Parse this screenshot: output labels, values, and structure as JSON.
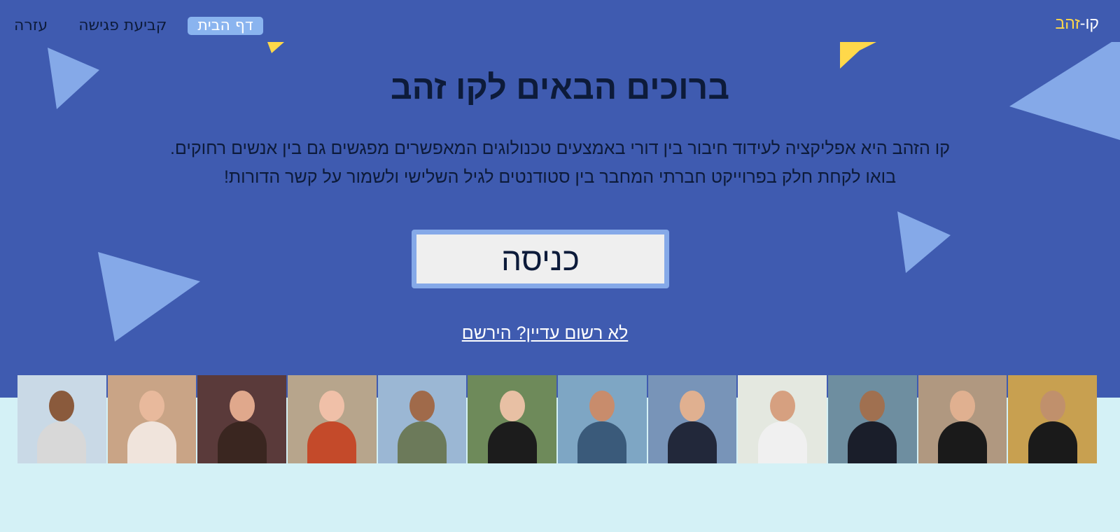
{
  "nav": {
    "items": [
      {
        "label": "עזרה"
      },
      {
        "label": "קביעת פגישה"
      },
      {
        "label": "דף הבית",
        "active": true
      }
    ]
  },
  "brand": {
    "part1": "קו-",
    "part2": "זהב"
  },
  "hero": {
    "title": "ברוכים הבאים לקו זהב",
    "description_lines": [
      "קו הזהב היא אפליקציה לעידוד חיבור בין דורי באמצעים טכנולוגים המאפשרים מפגשים גם בין אנשים רחוקים.",
      "בואו לקחת חלק בפרוייקט חברתי המחבר בין סטודנטים לגיל השלישי ולשמור על קשר הדורות!"
    ],
    "enter_button": "כניסה",
    "register_link": "לא רשום עדיין? הירשם"
  },
  "colors": {
    "hero_bg": "#3f5bb0",
    "page_bg": "#d4f1f6",
    "accent_light_blue": "#85a9e8",
    "accent_yellow": "#ffd84a",
    "text_dark": "#0d1b3a"
  },
  "photos": [
    {
      "name": "photo-1",
      "bg": "#c9d9e6",
      "head": "#8a5a3c",
      "body": "#d8d8d8"
    },
    {
      "name": "photo-2",
      "bg": "#c9a486",
      "head": "#e8b99c",
      "body": "#f0e4dc"
    },
    {
      "name": "photo-3",
      "bg": "#5a3a3a",
      "head": "#e0a88c",
      "body": "#3a2620"
    },
    {
      "name": "photo-4",
      "bg": "#b7a58c",
      "head": "#f0c0a8",
      "body": "#c44a2a"
    },
    {
      "name": "photo-5",
      "bg": "#9bb7d4",
      "head": "#a06a4a",
      "body": "#6c7a5a"
    },
    {
      "name": "photo-6",
      "bg": "#6e8a5a",
      "head": "#e8c0a4",
      "body": "#1c1c1c"
    },
    {
      "name": "photo-7",
      "bg": "#7ea6c4",
      "head": "#c88c6c",
      "body": "#3a5a7a"
    },
    {
      "name": "photo-8",
      "bg": "#7894b8",
      "head": "#e0b090",
      "body": "#22283a"
    },
    {
      "name": "photo-9",
      "bg": "#e4e8e0",
      "head": "#d6a080",
      "body": "#f0f0f0"
    },
    {
      "name": "photo-10",
      "bg": "#6e8ea0",
      "head": "#a07050",
      "body": "#1a1e2a"
    },
    {
      "name": "photo-11",
      "bg": "#b09880",
      "head": "#e0b090",
      "body": "#1a1a1a"
    },
    {
      "name": "photo-12",
      "bg": "#c8a050",
      "head": "#c0906c",
      "body": "#1a1a1a"
    }
  ]
}
